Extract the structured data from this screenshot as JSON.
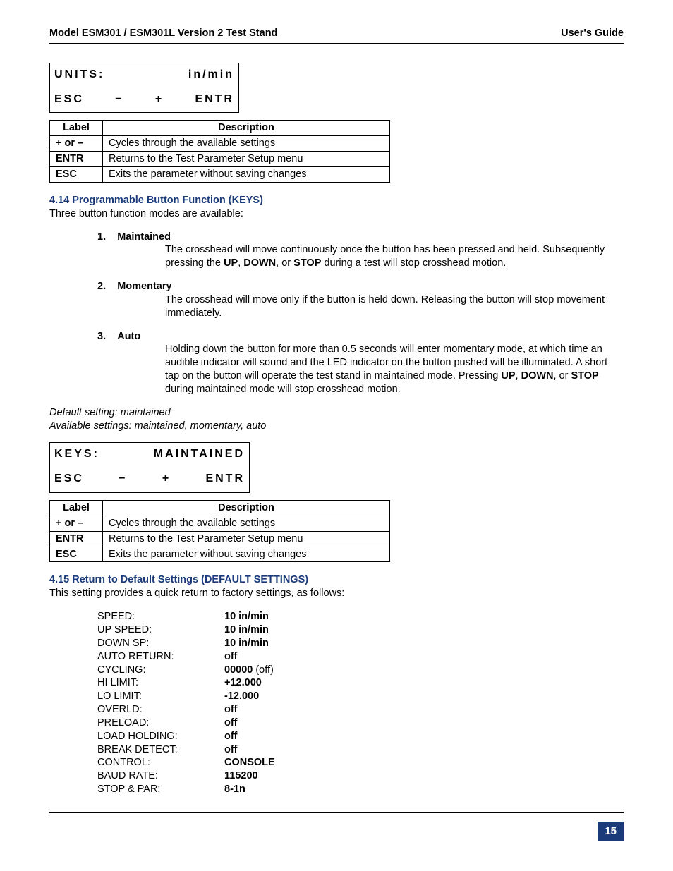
{
  "header": {
    "left": "Model ESM301 / ESM301L Version 2 Test Stand",
    "right": "User's Guide"
  },
  "lcd1": {
    "r1a": "UNITS:",
    "r1b": "in/min",
    "r2a": "ESC",
    "r2b": "−",
    "r2c": "+",
    "r2d": "ENTR"
  },
  "table1": {
    "h1": "Label",
    "h2": "Description",
    "rows": [
      {
        "label": "+ or –",
        "desc": "Cycles through the available settings"
      },
      {
        "label": "ENTR",
        "desc": "Returns to the Test Parameter Setup menu"
      },
      {
        "label": "ESC",
        "desc": "Exits the parameter without saving changes"
      }
    ]
  },
  "sec414": {
    "head": "4.14 Programmable Button Function (KEYS)",
    "intro": "Three button function modes are available:",
    "items": [
      {
        "num": "1.",
        "title": "Maintained",
        "body_a": "The crosshead will move continuously once the button has been pressed and held. Subsequently pressing the ",
        "b1": "UP",
        "c1": ", ",
        "b2": "DOWN",
        "c2": ", or ",
        "b3": "STOP",
        "body_z": " during a test will stop crosshead motion."
      },
      {
        "num": "2.",
        "title": "Momentary",
        "body": "The crosshead will move only if the button is held down. Releasing the button will stop movement immediately."
      },
      {
        "num": "3.",
        "title": "Auto",
        "body_a": "Holding down the button for more than 0.5 seconds will enter momentary mode, at which time an audible indicator will sound and the LED indicator on the button pushed will be illuminated. A short tap on the button will operate the test stand in maintained mode. Pressing ",
        "b1": "UP",
        "c1": ", ",
        "b2": "DOWN",
        "c2": ", or ",
        "b3": "STOP",
        "body_z": " during maintained mode will stop crosshead motion."
      }
    ],
    "default": "Default setting: maintained",
    "avail": "Available settings: maintained, momentary, auto"
  },
  "lcd2": {
    "r1a": "KEYS:",
    "r1b": "MAINTAINED",
    "r2a": "ESC",
    "r2b": "−",
    "r2c": "+",
    "r2d": "ENTR"
  },
  "table2": {
    "h1": "Label",
    "h2": "Description",
    "rows": [
      {
        "label": "+ or –",
        "desc": "Cycles through the available settings"
      },
      {
        "label": "ENTR",
        "desc": "Returns to the Test Parameter Setup menu"
      },
      {
        "label": "ESC",
        "desc": "Exits the parameter without saving changes"
      }
    ]
  },
  "sec415": {
    "head": "4.15 Return to Default Settings (DEFAULT SETTINGS)",
    "intro": "This setting provides a quick return to factory settings, as follows:",
    "rows": [
      {
        "label": "SPEED:",
        "val": "10 in/min"
      },
      {
        "label": "UP SPEED:",
        "val": "10 in/min"
      },
      {
        "label": "DOWN SP:",
        "val": "10 in/min"
      },
      {
        "label": "AUTO RETURN:",
        "val": "off"
      },
      {
        "label": "CYCLING:",
        "val": "00000",
        "extra": " (off)"
      },
      {
        "label": "HI LIMIT:",
        "val": "+12.000"
      },
      {
        "label": "LO LIMIT:",
        "val": "-12.000"
      },
      {
        "label": "OVERLD:",
        "val": "off"
      },
      {
        "label": "PRELOAD:",
        "val": "off"
      },
      {
        "label": "LOAD HOLDING:",
        "val": "off"
      },
      {
        "label": "BREAK DETECT:",
        "val": "off"
      },
      {
        "label": "CONTROL:",
        "val": "CONSOLE"
      },
      {
        "label": "BAUD RATE:",
        "val": "115200"
      },
      {
        "label": "STOP & PAR:",
        "val": "8-1n"
      }
    ]
  },
  "page": "15"
}
